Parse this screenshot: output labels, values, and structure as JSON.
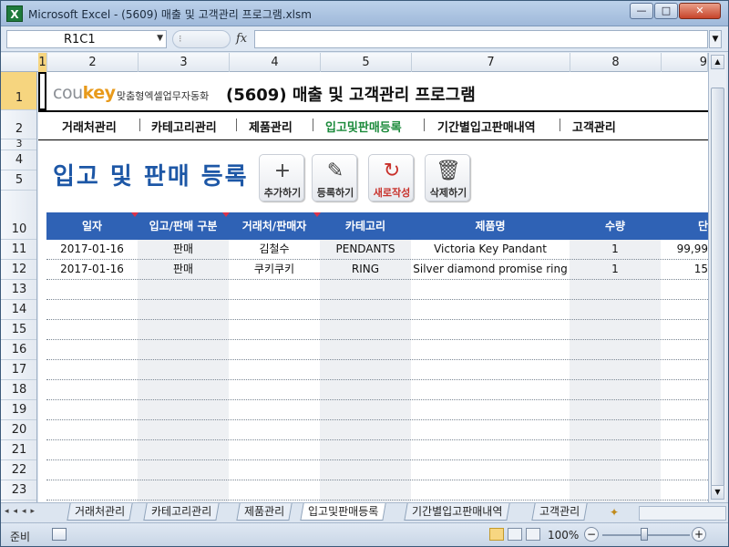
{
  "window": {
    "app_icon": "X",
    "title": "Microsoft Excel - (5609) 매출 및 고객관리 프로그램.xlsm",
    "minimize": "—",
    "maximize": "□",
    "close": "✕"
  },
  "formula_bar": {
    "name_box": "R1C1",
    "fx": "fx",
    "formula": ""
  },
  "columns": [
    "1",
    "2",
    "3",
    "4",
    "5",
    "7",
    "8",
    "9"
  ],
  "rows": [
    "1",
    "2",
    "3",
    "4",
    "5",
    "10",
    "11",
    "12",
    "13",
    "14",
    "15",
    "16",
    "17",
    "18",
    "19",
    "20",
    "21",
    "22",
    "23"
  ],
  "header": {
    "logo_main": "cou",
    "logo_accent": "key",
    "logo_sub": "맞춤형엑셀업무자동화",
    "title": "(5609) 매출 및 고객관리 프로그램"
  },
  "menu": {
    "items": [
      "거래처관리",
      "카테고리관리",
      "제품관리",
      "입고및판매등록",
      "기간별입고판매내역",
      "고객관리"
    ],
    "active_index": 3
  },
  "page_title": "입고 및 판매 등록",
  "toolbar": {
    "add": "추가하기",
    "register": "등록하기",
    "new": "새로작성",
    "delete": "삭제하기"
  },
  "table": {
    "headers": [
      "일자",
      "입고/판매 구분",
      "거래처/판매자",
      "카테고리",
      "제품명",
      "수량",
      "단"
    ],
    "rows": [
      [
        "2017-01-16",
        "판매",
        "김철수",
        "PENDANTS",
        "Victoria Key Pandant",
        "1",
        "99,99"
      ],
      [
        "2017-01-16",
        "판매",
        "쿠키쿠키",
        "RING",
        "Silver diamond promise ring",
        "1",
        "15"
      ]
    ]
  },
  "sheet_tabs": {
    "items": [
      "거래처관리",
      "카테고리관리",
      "제품관리",
      "입고및판매등록",
      "기간별입고판매내역",
      "고객관리"
    ],
    "active_index": 3
  },
  "status": {
    "ready": "준비",
    "zoom": "100%",
    "zoom_minus": "−",
    "zoom_plus": "+"
  },
  "colors": {
    "table_header": "#2f62b5",
    "title_blue": "#1d57a6",
    "active_menu": "#1a8a3a"
  }
}
